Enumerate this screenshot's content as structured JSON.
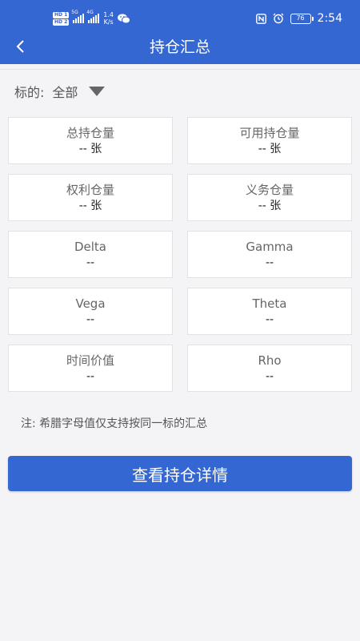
{
  "status_bar": {
    "hd1": "HD 1",
    "hd2": "HD 2",
    "sig1_label": "5G",
    "sig2_label": "4G",
    "speed_top": "1.4",
    "speed_bottom": "K/s",
    "battery": "76",
    "time": "2:54"
  },
  "header": {
    "title": "持仓汇总"
  },
  "filter": {
    "label": "标的:",
    "value": "全部"
  },
  "cards": [
    {
      "label": "总持仓量",
      "value": "-- 张"
    },
    {
      "label": "可用持仓量",
      "value": "-- 张"
    },
    {
      "label": "权利仓量",
      "value": "-- 张"
    },
    {
      "label": "义务仓量",
      "value": "-- 张"
    },
    {
      "label": "Delta",
      "value": "--"
    },
    {
      "label": "Gamma",
      "value": "--"
    },
    {
      "label": "Vega",
      "value": "--"
    },
    {
      "label": "Theta",
      "value": "--"
    },
    {
      "label": "时间价值",
      "value": "--"
    },
    {
      "label": "Rho",
      "value": "--"
    }
  ],
  "note": "注:  希腊字母值仅支持按同一标的汇总",
  "button": {
    "label": "查看持仓详情"
  },
  "colors": {
    "primary": "#3567d2",
    "background": "#f4f4f6",
    "card": "#ffffff"
  },
  "icons": [
    "back-arrow-icon",
    "dropdown-triangle-icon",
    "wechat-icon",
    "nfc-icon",
    "alarm-icon",
    "battery-icon",
    "signal-icon"
  ]
}
